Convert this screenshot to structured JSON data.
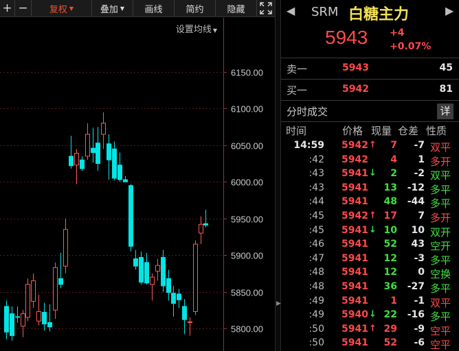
{
  "toolbar": {
    "zoom_in": "+",
    "zoom_out": "−",
    "adjust": "复权",
    "overlay": "叠加",
    "draw": "画线",
    "simple": "简约",
    "hide": "隐藏",
    "fullscreen_icon": "fullscreen-icon"
  },
  "chart": {
    "ma_setting": "设置均线",
    "price_axis": [
      "6150.00",
      "6100.00",
      "6050.00",
      "6000.00",
      "5950.00",
      "5900.00",
      "5850.00",
      "5800.00"
    ],
    "colors": {
      "up": "#ff5a5a",
      "down": "#00e5e5",
      "grid": "#5a1a1a",
      "axis_text": "#cccccc"
    }
  },
  "chart_data": {
    "type": "candlestick",
    "ylim": [
      5780,
      6175
    ],
    "yticks": [
      6150,
      6100,
      6050,
      6000,
      5950,
      5900,
      5850,
      5800
    ],
    "candles": [
      {
        "o": 5830,
        "h": 5838,
        "l": 5785,
        "c": 5795
      },
      {
        "o": 5820,
        "h": 5830,
        "l": 5783,
        "c": 5790
      },
      {
        "o": 5816,
        "h": 5830,
        "l": 5808,
        "c": 5815
      },
      {
        "o": 5803,
        "h": 5825,
        "l": 5788,
        "c": 5820
      },
      {
        "o": 5815,
        "h": 5868,
        "l": 5810,
        "c": 5860
      },
      {
        "o": 5837,
        "h": 5875,
        "l": 5828,
        "c": 5865
      },
      {
        "o": 5810,
        "h": 5846,
        "l": 5804,
        "c": 5823
      },
      {
        "o": 5822,
        "h": 5835,
        "l": 5797,
        "c": 5806
      },
      {
        "o": 5808,
        "h": 5833,
        "l": 5796,
        "c": 5802
      },
      {
        "o": 5825,
        "h": 5890,
        "l": 5813,
        "c": 5883
      },
      {
        "o": 5868,
        "h": 5903,
        "l": 5855,
        "c": 5860
      },
      {
        "o": 5885,
        "h": 5950,
        "l": 5875,
        "c": 5935
      },
      {
        "o": 6035,
        "h": 6063,
        "l": 6018,
        "c": 6022
      },
      {
        "o": 6023,
        "h": 6045,
        "l": 5997,
        "c": 6039
      },
      {
        "o": 6030,
        "h": 6035,
        "l": 6015,
        "c": 6018
      },
      {
        "o": 6035,
        "h": 6080,
        "l": 6030,
        "c": 6065
      },
      {
        "o": 6046,
        "h": 6074,
        "l": 6026,
        "c": 6040
      },
      {
        "o": 6053,
        "h": 6075,
        "l": 6015,
        "c": 6025
      },
      {
        "o": 6065,
        "h": 6095,
        "l": 6045,
        "c": 6080
      },
      {
        "o": 6052,
        "h": 6065,
        "l": 6003,
        "c": 6030
      },
      {
        "o": 6045,
        "h": 6055,
        "l": 6002,
        "c": 6005
      },
      {
        "o": 6023,
        "h": 6040,
        "l": 6000,
        "c": 6003
      },
      {
        "o": 6003,
        "h": 6008,
        "l": 6000,
        "c": 6000
      },
      {
        "o": 5995,
        "h": 5997,
        "l": 5905,
        "c": 5912
      },
      {
        "o": 5895,
        "h": 5907,
        "l": 5880,
        "c": 5885
      },
      {
        "o": 5897,
        "h": 5905,
        "l": 5860,
        "c": 5863
      },
      {
        "o": 5890,
        "h": 5903,
        "l": 5860,
        "c": 5862
      },
      {
        "o": 5860,
        "h": 5875,
        "l": 5838,
        "c": 5870
      },
      {
        "o": 5878,
        "h": 5895,
        "l": 5865,
        "c": 5886
      },
      {
        "o": 5897,
        "h": 5907,
        "l": 5850,
        "c": 5858
      },
      {
        "o": 5868,
        "h": 5880,
        "l": 5838,
        "c": 5849
      },
      {
        "o": 5848,
        "h": 5858,
        "l": 5816,
        "c": 5834
      },
      {
        "o": 5847,
        "h": 5854,
        "l": 5828,
        "c": 5839
      },
      {
        "o": 5830,
        "h": 5840,
        "l": 5792,
        "c": 5812
      },
      {
        "o": 5808,
        "h": 5815,
        "l": 5790,
        "c": 5809
      },
      {
        "o": 5823,
        "h": 5920,
        "l": 5818,
        "c": 5915
      },
      {
        "o": 5930,
        "h": 5953,
        "l": 5915,
        "c": 5942
      },
      {
        "o": 5943,
        "h": 5962,
        "l": 5938,
        "c": 5941
      }
    ]
  },
  "quote": {
    "code": "SRM",
    "name": "白糖主力",
    "last": "5943",
    "change": "+4",
    "change_pct": "+0.07%",
    "sell_label": "卖一",
    "sell_price": "5943",
    "sell_vol": "45",
    "buy_label": "买一",
    "buy_price": "5942",
    "buy_vol": "81",
    "timesales_title": "分时成交",
    "detail": "详",
    "col_time": "时间",
    "col_price": "价格",
    "col_vol": "现量",
    "col_oi": "仓差",
    "col_nature": "性质"
  },
  "ticks": [
    {
      "time": "14:59",
      "price": "5942",
      "arrow": "↑",
      "vol": "7",
      "oi": "-7",
      "nature": "双平",
      "dir": "up"
    },
    {
      "time": ":42",
      "price": "5942",
      "arrow": "",
      "vol": "4",
      "oi": "1",
      "nature": "多开",
      "dir": "up"
    },
    {
      "time": ":43",
      "price": "5941",
      "arrow": "↓",
      "vol": "2",
      "oi": "-2",
      "nature": "双平",
      "dir": "down"
    },
    {
      "time": ":43",
      "price": "5941",
      "arrow": "",
      "vol": "13",
      "oi": "-12",
      "nature": "多平",
      "dir": "down"
    },
    {
      "time": ":44",
      "price": "5941",
      "arrow": "",
      "vol": "48",
      "oi": "-44",
      "nature": "多平",
      "dir": "down"
    },
    {
      "time": ":45",
      "price": "5942",
      "arrow": "↑",
      "vol": "17",
      "oi": "7",
      "nature": "多开",
      "dir": "up"
    },
    {
      "time": ":45",
      "price": "5941",
      "arrow": "↓",
      "vol": "10",
      "oi": "10",
      "nature": "双开",
      "dir": "down"
    },
    {
      "time": ":46",
      "price": "5941",
      "arrow": "",
      "vol": "52",
      "oi": "43",
      "nature": "空开",
      "dir": "down"
    },
    {
      "time": ":47",
      "price": "5941",
      "arrow": "",
      "vol": "12",
      "oi": "-3",
      "nature": "多平",
      "dir": "down"
    },
    {
      "time": ":48",
      "price": "5941",
      "arrow": "",
      "vol": "12",
      "oi": "0",
      "nature": "空换",
      "dir": "down"
    },
    {
      "time": ":48",
      "price": "5941",
      "arrow": "",
      "vol": "36",
      "oi": "-27",
      "nature": "多平",
      "dir": "down"
    },
    {
      "time": ":49",
      "price": "5941",
      "arrow": "",
      "vol": "1",
      "oi": "-1",
      "nature": "双平",
      "dir": "up"
    },
    {
      "time": ":49",
      "price": "5940",
      "arrow": "↓",
      "vol": "22",
      "oi": "-16",
      "nature": "多平",
      "dir": "down"
    },
    {
      "time": ":50",
      "price": "5941",
      "arrow": "↑",
      "vol": "29",
      "oi": "-9",
      "nature": "空平",
      "dir": "up"
    },
    {
      "time": ":50",
      "price": "5941",
      "arrow": "",
      "vol": "52",
      "oi": "-6",
      "nature": "空平",
      "dir": "up"
    }
  ]
}
